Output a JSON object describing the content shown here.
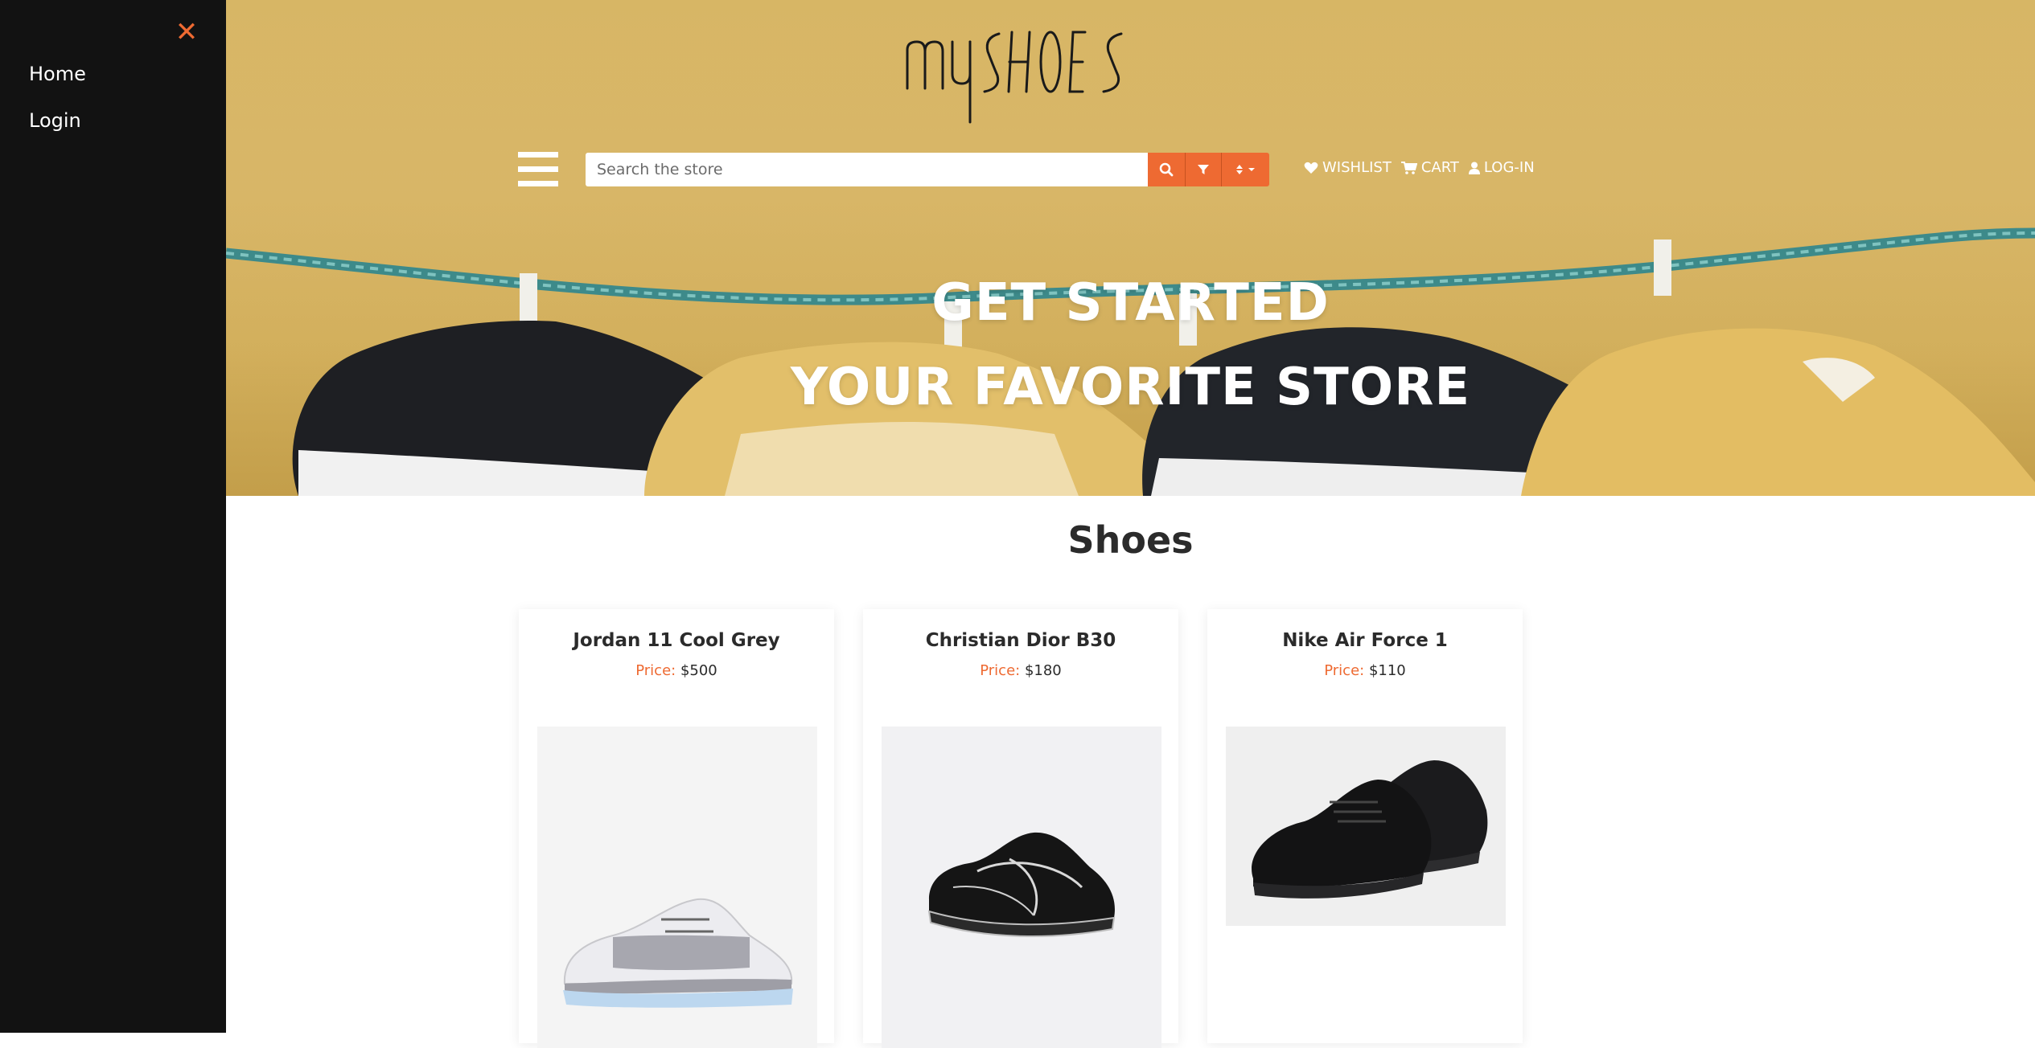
{
  "sidebar": {
    "close_symbol": "✕",
    "items": [
      {
        "label": "Home"
      },
      {
        "label": "Login"
      }
    ]
  },
  "header": {
    "logo_text": "myShoes",
    "search": {
      "placeholder": "Search the store",
      "value": ""
    },
    "links": [
      {
        "icon": "heart-icon",
        "label": "WISHLIST"
      },
      {
        "icon": "cart-icon",
        "label": "CART"
      },
      {
        "icon": "user-icon",
        "label": "LOG-IN"
      }
    ]
  },
  "hero": {
    "line1": "GET STARTED",
    "line2": "YOUR FAVORITE STORE"
  },
  "products": {
    "section_title": "Shoes",
    "price_label": "Price:",
    "items": [
      {
        "name": "Jordan 11 Cool Grey",
        "price": "$500"
      },
      {
        "name": "Christian Dior B30",
        "price": "$180"
      },
      {
        "name": "Nike Air Force 1",
        "price": "$110"
      }
    ]
  },
  "colors": {
    "accent": "#ee6a32",
    "sidebar_bg": "#121212",
    "hero_bg": "#d7b665"
  }
}
